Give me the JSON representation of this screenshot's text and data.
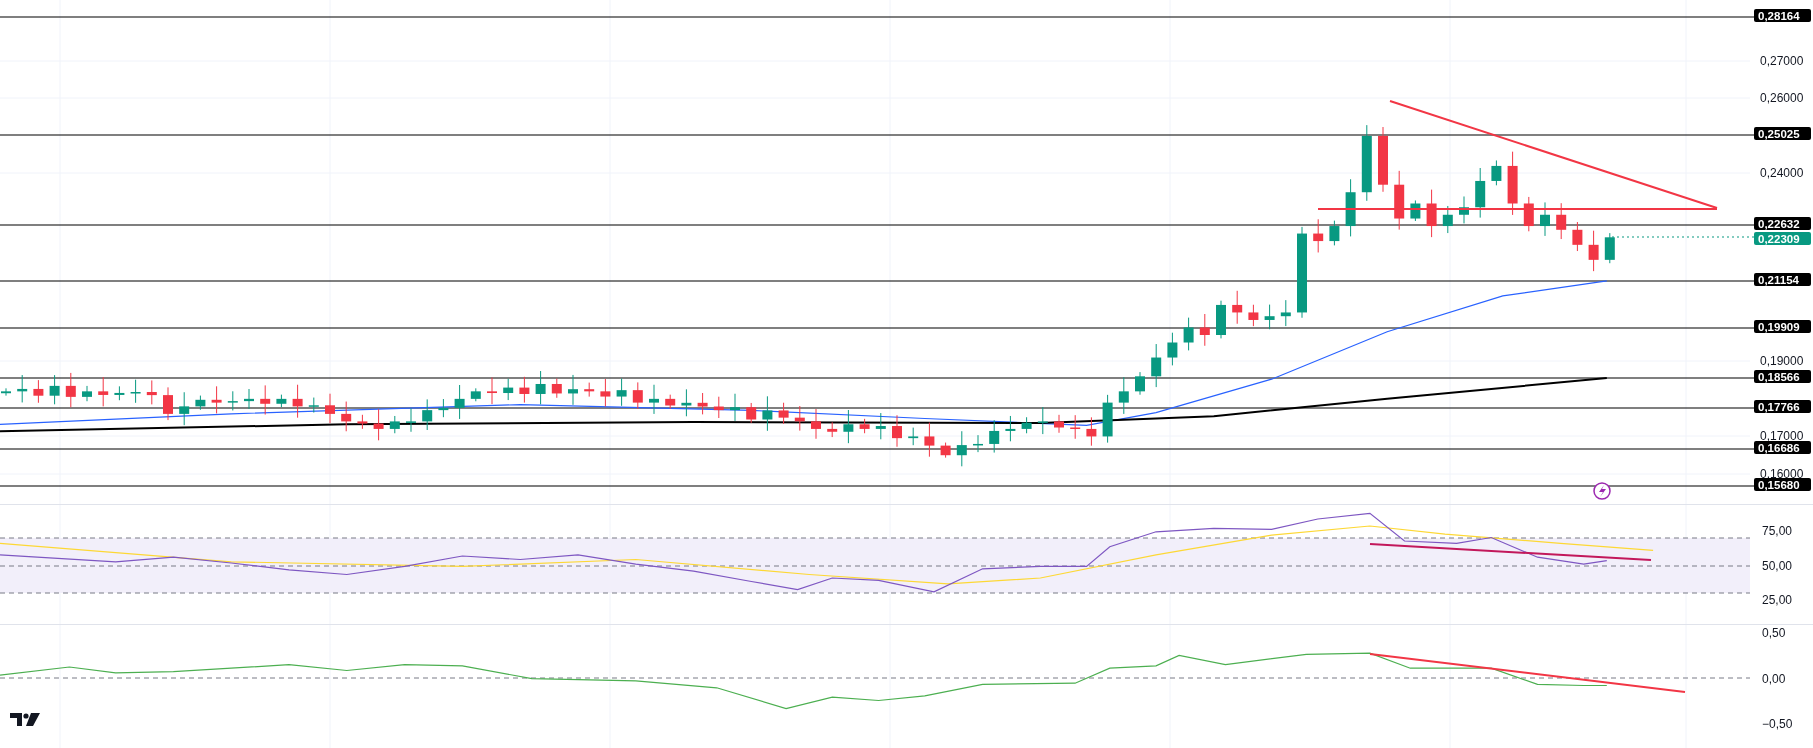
{
  "price_pane": {
    "ticks": [
      "0,27000",
      "0,26000",
      "0,24000",
      "0,19000",
      "0,17000",
      "0,16000"
    ],
    "levels": [
      {
        "label": "0,28164",
        "kind": "level"
      },
      {
        "label": "0,25025",
        "kind": "level"
      },
      {
        "label": "0,22632",
        "kind": "level"
      },
      {
        "label": "0,22309",
        "kind": "current"
      },
      {
        "label": "0,21154",
        "kind": "level"
      },
      {
        "label": "0,19909",
        "kind": "level"
      },
      {
        "label": "0,18566",
        "kind": "level"
      },
      {
        "label": "0,17766",
        "kind": "level"
      },
      {
        "label": "0,16686",
        "kind": "level"
      },
      {
        "label": "0,15680",
        "kind": "level"
      }
    ]
  },
  "rsi_pane": {
    "ticks": [
      "75,00",
      "50,00",
      "25,00"
    ]
  },
  "oscillator_pane": {
    "ticks": [
      "0,50",
      "0,00",
      "−0,50"
    ]
  }
}
